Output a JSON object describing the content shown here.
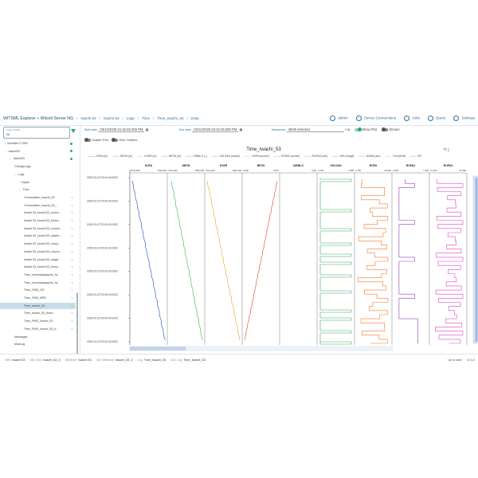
{
  "header": {
    "brand": "WITSML Explorer",
    "server_prefix": "»",
    "server": "Witsml Server NG",
    "breadcrumbs": [
      "Iwachi 53",
      "Iwachi 53",
      "Logs",
      "Time",
      "Time_Iwachi_53",
      "Data"
    ],
    "actions": [
      "admin",
      "Server Connections",
      "Jobs",
      "Query",
      "Settings"
    ]
  },
  "sidebar": {
    "search_label": "Search Wells",
    "search_value": "Iw",
    "tree": [
      {
        "label": "Arandleh 3 SSR",
        "level": 0,
        "chev": "›",
        "dot": true
      },
      {
        "label": "Iwachi53",
        "level": 0,
        "chev": "⌄",
        "dot": true
      },
      {
        "label": "Iwachi53",
        "level": 1,
        "chev": "⌄",
        "dot": true
      },
      {
        "label": "ChangeLogs",
        "level": 2,
        "chev": ""
      },
      {
        "label": "Logs",
        "level": 2,
        "chev": "⌄"
      },
      {
        "label": "Depth",
        "level": 3,
        "chev": "›"
      },
      {
        "label": "Time",
        "level": 3,
        "chev": "⌄"
      },
      {
        "label": "Cementation_Iwachi_53",
        "level": 4,
        "chev": ""
      },
      {
        "label": "Cementation_Iwachi_53_...",
        "level": 4,
        "chev": ""
      },
      {
        "label": "Iwachi 53_Iwachi 53_active...",
        "level": 4,
        "chev": ""
      },
      {
        "label": "Iwachi 53_Iwachi 53_Biosu...",
        "level": 4,
        "chev": ""
      },
      {
        "label": "Iwachi 53_Iwachi 53_cemen...",
        "level": 4,
        "chev": ""
      },
      {
        "label": "Iwachi 53_Iwachi 53_dashb...",
        "level": 4,
        "chev": ""
      },
      {
        "label": "Iwachi 53_Iwachi 53_hazyi...",
        "level": 4,
        "chev": ""
      },
      {
        "label": "Iwachi 53_Iwachi 53_miscel...",
        "level": 4,
        "chev": ""
      },
      {
        "label": "Iwachi 53_Iwachi 53_stage...",
        "level": 4,
        "chev": ""
      },
      {
        "label": "Iwachi 53_Iwachi 53_temp...",
        "level": 4,
        "chev": ""
      },
      {
        "label": "Time_chromatographic_Iw...",
        "level": 4,
        "chev": ""
      },
      {
        "label": "Time_chromatographic_Iw...",
        "level": 4,
        "chev": ""
      },
      {
        "label": "Time_GSM_OD",
        "level": 4,
        "chev": ""
      },
      {
        "label": "Time_GSM_MPD",
        "level": 4,
        "chev": ""
      },
      {
        "label": "Time_Iwachi_53",
        "level": 4,
        "chev": "",
        "selected": true
      },
      {
        "label": "Time_Iwachi_53_down",
        "level": 4,
        "chev": ""
      },
      {
        "label": "Time_PWD_Iwachi_53",
        "level": 4,
        "chev": ""
      },
      {
        "label": "Time_PWD_Iwachi_53_d...",
        "level": 4,
        "chev": ""
      },
      {
        "label": "Messages",
        "level": 2,
        "chev": ""
      },
      {
        "label": "MudLog",
        "level": 2,
        "chev": ""
      }
    ]
  },
  "controls": {
    "start_label": "Start index",
    "start_value": "03/12/2025 01:42:45.000  PM",
    "end_label": "End index",
    "end_value": "03/12/2025 02:42:45.000  PM",
    "mnemonics_label": "Mnemonics",
    "mnemonics_value": "49/49 selected",
    "show_plot": "Show Plot",
    "stream": "Stream",
    "scatter_plot": "Scatter Plot",
    "hide_outliers": "Hide Outliers"
  },
  "chart_data": {
    "type": "line",
    "title": "Time_Iwachi_53",
    "legend": [
      "DVEA (m)",
      "DBTM (m)",
      "DVER (m)",
      "BPOS (m)",
      "DIRBLO (--)",
      "VELGAN (m/min)",
      "ROPA (m/min)",
      "ROPA2 (m/min)",
      "ROPA3 (m/h)",
      "HKLA (kkgf)",
      "WOBA (ton)",
      "TGA (lbf/ft)",
      "SP..."
    ],
    "tracks": [
      {
        "name": "DVEA",
        "min": "7644.828",
        "max": "7649.050",
        "color": "#1f3fd0",
        "shape": "down-right"
      },
      {
        "name": "DBTM",
        "min": "7644.000",
        "max": "7845.000",
        "color": "#39b24a",
        "shape": "down-right"
      },
      {
        "name": "DVER",
        "min": "7644.000",
        "max": "7900.000",
        "color": "#f29a1d",
        "shape": "down-right"
      },
      {
        "name": "BPOS",
        "min": "0.000",
        "max": "0.970",
        "color": "#e4432c",
        "shape": "down-left"
      },
      {
        "name": "DIRBLO",
        "min": "",
        "max": "NaN",
        "color": "#8a4fb8",
        "shape": "none"
      },
      {
        "name": "VELGAN",
        "min": "0.148",
        "max": "1.880",
        "color": "#3aa860",
        "shape": "square"
      },
      {
        "name": "ROPA",
        "min": "0.750",
        "max": "46.836",
        "color": "#f27a28",
        "shape": "step"
      },
      {
        "name": "ROPA2",
        "min": "0.000",
        "max": "7.096",
        "color": "#8a40b8",
        "shape": "step2"
      },
      {
        "name": "ROPA3",
        "min": "14.400",
        "max": "16.380",
        "color": "#d946c8",
        "shape": "step3"
      }
    ],
    "y_ticks": [
      "2025-03-12T19:42:45.000Z",
      "2025-03-12T19:50:00.000Z",
      "2025-03-12T20:00:00.000Z",
      "2025-03-12T20:10:00.000Z",
      "2025-03-12T20:20:00.000Z",
      "2025-03-12T20:30:00.000Z",
      "2025-03-12T20:40:00.000Z",
      "2025-03-12T20:42:45.000Z"
    ]
  },
  "statusbar": {
    "items": [
      {
        "k": "Well",
        "v": "Iwachi 53"
      },
      {
        "k": "UID Well",
        "v": "Iwachi_53_3"
      },
      {
        "k": "Wellbore",
        "v": "Iwachi 53"
      },
      {
        "k": "UID Wellbore",
        "v": "Iwachi_53_3"
      },
      {
        "k": "Log",
        "v": "Time_Iwachi_53"
      },
      {
        "k": "UID Log",
        "v": "Time_Iwachi_53"
      }
    ],
    "right": [
      "Up to date",
      "v2.4.0"
    ]
  }
}
